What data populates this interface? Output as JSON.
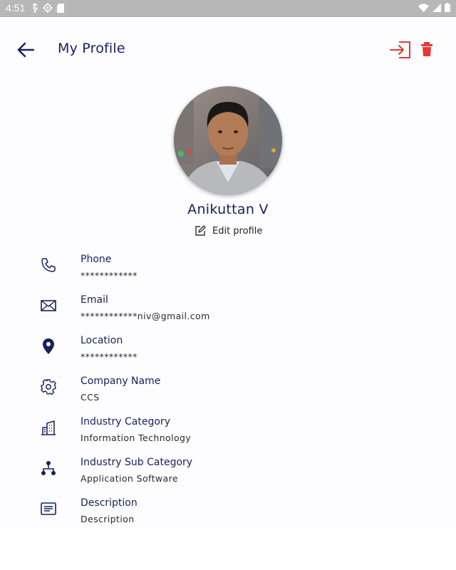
{
  "status_bar": {
    "time": "4:51"
  },
  "header": {
    "title": "My Profile"
  },
  "profile": {
    "name": "Anikuttan V",
    "edit_label": "Edit profile"
  },
  "fields": [
    {
      "icon": "phone-icon",
      "label": "Phone",
      "value": "************"
    },
    {
      "icon": "mail-icon",
      "label": "Email",
      "value": "************niv@gmail.com"
    },
    {
      "icon": "location-pin-icon",
      "label": "Location",
      "value": "************"
    },
    {
      "icon": "gear-icon",
      "label": "Company Name",
      "value": "CCS"
    },
    {
      "icon": "buildings-icon",
      "label": "Industry Category",
      "value": "Information Technology"
    },
    {
      "icon": "hierarchy-icon",
      "label": "Industry Sub Category",
      "value": "Application Software"
    },
    {
      "icon": "description-icon",
      "label": "Description",
      "value": "Description"
    }
  ],
  "colors": {
    "primary": "#17215a",
    "danger": "#e53935",
    "status_bar": "#b7b7b7"
  }
}
